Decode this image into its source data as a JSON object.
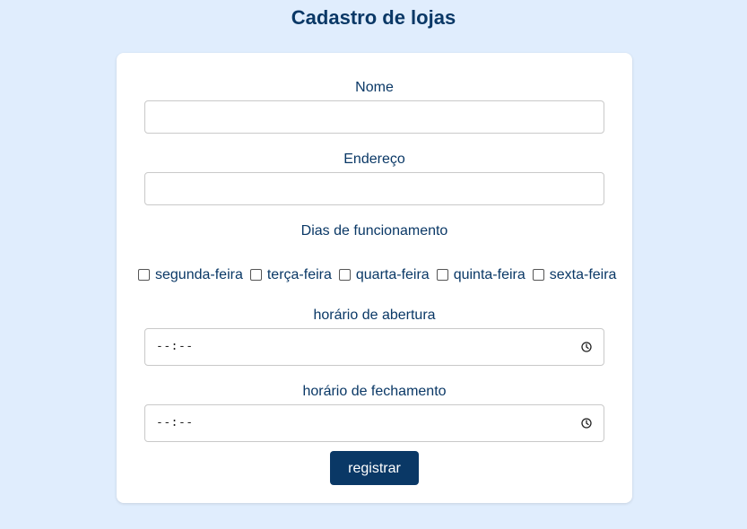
{
  "page": {
    "title": "Cadastro de lojas"
  },
  "form": {
    "nome": {
      "label": "Nome",
      "value": ""
    },
    "endereco": {
      "label": "Endereço",
      "value": ""
    },
    "dias": {
      "label": "Dias de funcionamento",
      "options": [
        {
          "label": "segunda-feira",
          "checked": false
        },
        {
          "label": "terça-feira",
          "checked": false
        },
        {
          "label": "quarta-feira",
          "checked": false
        },
        {
          "label": "quinta-feira",
          "checked": false
        },
        {
          "label": "sexta-feira",
          "checked": false
        }
      ]
    },
    "abertura": {
      "label": "horário de abertura",
      "placeholder": "--:--"
    },
    "fechamento": {
      "label": "horário de fechamento",
      "placeholder": "--:--"
    },
    "submit_label": "registrar"
  },
  "colors": {
    "background": "#e0edfd",
    "text": "#0a3866",
    "button": "#0a3866",
    "card": "#ffffff"
  },
  "icons": {
    "time_picker": "clock-icon"
  }
}
